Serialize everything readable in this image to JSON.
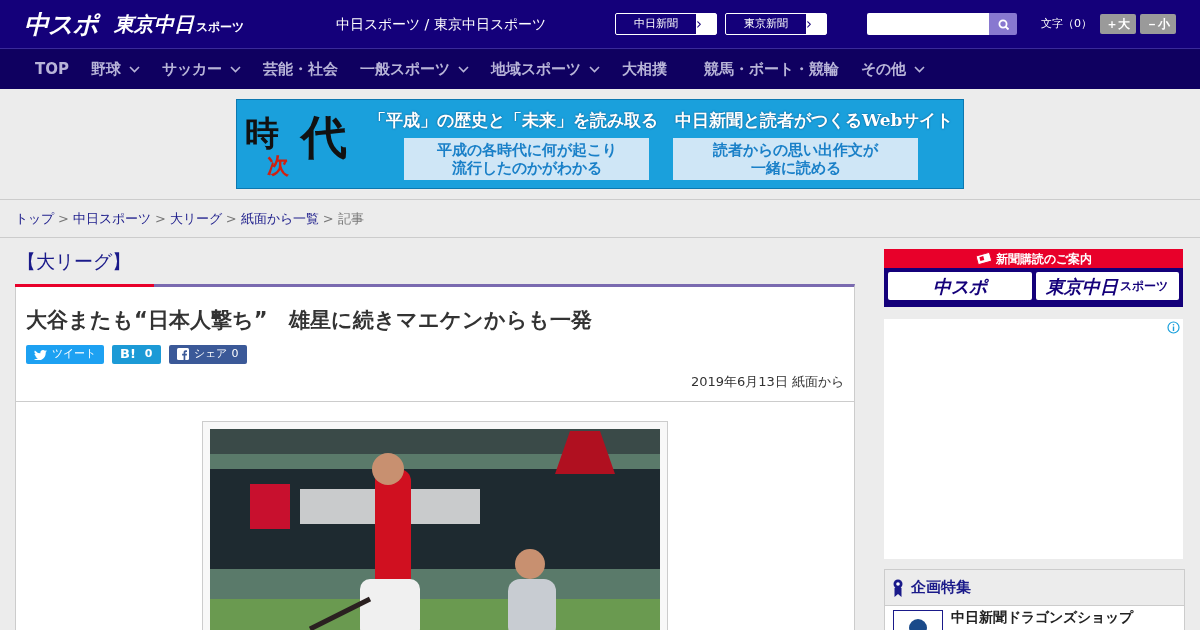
{
  "header": {
    "logo_main": "中スポ",
    "logo_sub": "東京中日",
    "logo_sub_small": "スポーツ",
    "site_name": "中日スポーツ / 東京中日スポーツ",
    "links": [
      {
        "label": "中日新聞",
        "arrow": "›"
      },
      {
        "label": "東京新聞",
        "arrow": "›"
      }
    ],
    "font_size": {
      "label": "文字（0）",
      "buttons": [
        "＋大",
        "－小"
      ]
    }
  },
  "nav": [
    {
      "label": "TOP",
      "dropdown": false
    },
    {
      "label": "野球",
      "dropdown": true
    },
    {
      "label": "サッカー",
      "dropdown": true
    },
    {
      "label": "芸能・社会",
      "dropdown": false
    },
    {
      "label": "一般スポーツ",
      "dropdown": true
    },
    {
      "label": "地域スポーツ",
      "dropdown": true
    },
    {
      "label": "大相撲",
      "dropdown": false
    },
    {
      "label": "競馬・ボート・競輪",
      "dropdown": false
    },
    {
      "label": "その他",
      "dropdown": true
    }
  ],
  "banner": {
    "logo": [
      "時",
      "次",
      "代"
    ],
    "headline": "「平成」の歴史と「未来」を読み取る　中日新聞と読者がつくるWebサイト",
    "boxes": [
      [
        "平成の各時代に何が起こり",
        "流行したのかがわかる"
      ],
      [
        "読者からの思い出作文が",
        "一緒に読める"
      ]
    ]
  },
  "breadcrumb": {
    "links": [
      "トップ",
      "中日スポーツ",
      "大リーグ",
      "紙面から一覧"
    ],
    "separator": ">",
    "current": "記事"
  },
  "category": "【大リーグ】",
  "article": {
    "title": "大谷またも“日本人撃ち”　雄星に続きマエケンからも一発",
    "share": [
      {
        "kind": "twitter",
        "label": "ツイート"
      },
      {
        "kind": "hatena",
        "label": "B!",
        "count": "0"
      },
      {
        "kind": "facebook",
        "label": "シェア",
        "count": "0"
      }
    ],
    "date": "2019年6月13日 紙面から"
  },
  "sidebar": {
    "subscribe": {
      "title": "新聞購読のご案内",
      "logo_main": "中スポ",
      "logo_sub": "東京中日",
      "logo_sub_small": "スポーツ"
    },
    "feature": {
      "title": "企画特集",
      "items": [
        "中日新聞ドラゴンズショップ"
      ]
    }
  }
}
